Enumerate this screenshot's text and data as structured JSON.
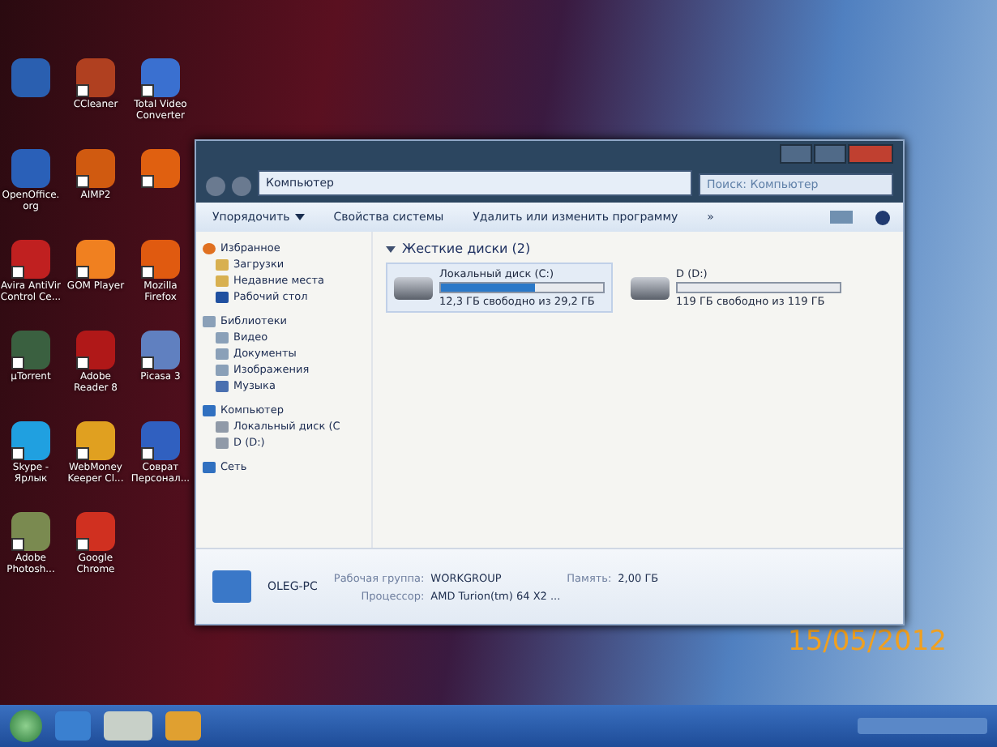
{
  "desktop_icons": [
    {
      "kind": "app",
      "color": "#2a5fb0"
    },
    {
      "kind": "shortcut",
      "label": "CCleaner",
      "color": "#b04020"
    },
    {
      "kind": "shortcut",
      "label": "Total Video Converter",
      "color": "#3a70d0"
    },
    {
      "kind": "app",
      "label": "OpenOffice.org",
      "color": "#2a60b8"
    },
    {
      "kind": "shortcut",
      "label": "AIMP2",
      "color": "#d05a10"
    },
    {
      "kind": "shortcut",
      "color": "#e06010"
    },
    {
      "kind": "shortcut",
      "label": "Avira AntiVir Control Ce...",
      "color": "#c02020"
    },
    {
      "kind": "shortcut",
      "label": "GOM Player",
      "color": "#f08020"
    },
    {
      "kind": "shortcut",
      "label": "Mozilla Firefox",
      "color": "#e05a10"
    },
    {
      "kind": "shortcut",
      "label": "µTorrent",
      "color": "#3a6040"
    },
    {
      "kind": "shortcut",
      "label": "Adobe Reader 8",
      "color": "#b01818"
    },
    {
      "kind": "shortcut",
      "label": "Picasa 3",
      "color": "#6080c0"
    },
    {
      "kind": "shortcut",
      "label": "Skype - Ярлык",
      "color": "#20a0e0"
    },
    {
      "kind": "shortcut",
      "label": "WebMoney Keeper Cl...",
      "color": "#e0a020"
    },
    {
      "kind": "shortcut",
      "label": "Соврат Персонал...",
      "color": "#3060c0"
    },
    {
      "kind": "shortcut",
      "label": "Adobe Photosh...",
      "color": "#7a8a50"
    },
    {
      "kind": "shortcut",
      "label": "Google Chrome",
      "color": "#d03020"
    }
  ],
  "window": {
    "address": "Компьютер",
    "search": {
      "placeholder": "Поиск: Компьютер"
    },
    "toolbar": [
      {
        "kind": "menu",
        "label": "Упорядочить"
      },
      {
        "kind": "plain",
        "label": "Свойства системы"
      },
      {
        "kind": "plain",
        "label": "Удалить или изменить программу"
      },
      {
        "kind": "more",
        "label": "»"
      }
    ],
    "nav": [
      {
        "label": "Избранное",
        "children": [
          {
            "label": "Загрузки"
          },
          {
            "label": "Недавние места"
          },
          {
            "label": "Рабочий стол"
          }
        ]
      },
      {
        "label": "Библиотеки",
        "children": [
          {
            "label": "Видео"
          },
          {
            "label": "Документы"
          },
          {
            "label": "Изображения"
          },
          {
            "label": "Музыка"
          }
        ]
      },
      {
        "label": "Компьютер",
        "children": [
          {
            "label": "Локальный диск (C"
          },
          {
            "label": "D (D:)"
          }
        ]
      },
      {
        "label": "Сеть"
      }
    ],
    "group": {
      "title": "Жесткие диски (2)",
      "expanded": true
    },
    "drives": [
      {
        "name": "Локальный диск (C:)",
        "level": 0.58,
        "free": "12,3 ГБ свободно из 29,2 ГБ",
        "selected": true
      },
      {
        "name": "D (D:)",
        "level": 0.0,
        "free": "119 ГБ свободно из 119 ГБ",
        "selected": false
      }
    ],
    "details": {
      "computer": "OLEG-PC",
      "fields": [
        {
          "label": "Рабочая группа:",
          "value": "WORKGROUP"
        },
        {
          "label": "Память:",
          "value": "2,00 ГБ"
        },
        {
          "label": "Процессор:",
          "value": "AMD Turion(tm) 64 X2 ..."
        }
      ]
    }
  },
  "date_stamp": "15/05/2012"
}
